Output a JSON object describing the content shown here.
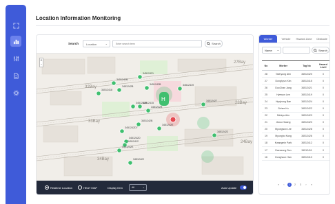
{
  "page": {
    "title": "Location Information Monitoring"
  },
  "sidebar": {
    "items": [
      {
        "icon": "expand-icon"
      },
      {
        "icon": "chart-icon",
        "active": true
      },
      {
        "icon": "sliders-icon"
      },
      {
        "icon": "document-icon"
      },
      {
        "icon": "gear-icon"
      }
    ]
  },
  "search": {
    "label": "Search",
    "category": "Location",
    "placeholder": "Enter search term",
    "button": "Search"
  },
  "map": {
    "bay_labels": [
      "27Bay",
      "32Bay",
      "28Bay",
      "33Bay",
      "24Bay",
      "34Bay"
    ],
    "tags": [
      "34512421",
      "3451242B",
      "3451242B",
      "3451242B",
      "34512419",
      "34512427",
      "34512418",
      "3451242B",
      "34512415",
      "3451242B",
      "3451242B",
      "3451242D7",
      "3451242D",
      "3451242E",
      "34512412",
      "3451242E",
      "34512422",
      "34512422",
      "3451242B"
    ],
    "zoom_in": "+",
    "zoom_out": "-"
  },
  "map_bottom": {
    "realtime_label": "Realtime Location",
    "heatmap_label": "HEAT MAP",
    "display_label": "Display Item",
    "display_value": "All",
    "auto_update_label": "Auto Update"
  },
  "right_panel": {
    "tabs": [
      "Worker",
      "Vehicle",
      "Hazard Zone",
      "Obstacle"
    ],
    "filter": {
      "field": "Name",
      "button": "Search"
    },
    "columns": [
      "No",
      "Worker",
      "Tag No",
      "Hazard Level"
    ],
    "rows": [
      [
        "28",
        "Taehyung Ahn",
        "34512420",
        "0"
      ],
      [
        "27",
        "Donghyun Kim",
        "34512415",
        "0"
      ],
      [
        "26",
        "DooChan Jang",
        "34512421",
        "0"
      ],
      [
        "25",
        "Hyewon Lee",
        "34512419",
        "0"
      ],
      [
        "24",
        "Hyojeong Bae",
        "34512424",
        "0"
      ],
      [
        "23",
        "Sohee Ko",
        "34512422",
        "0"
      ],
      [
        "22",
        "Minkyu Ahn",
        "34512423",
        "0"
      ],
      [
        "21",
        "Jiwoo Hwang",
        "34512423",
        "0"
      ],
      [
        "20",
        "Myungwon Lee",
        "34512428",
        "0"
      ],
      [
        "19",
        "Myungho Kang",
        "34512426",
        "0"
      ],
      [
        "18",
        "Kwangmin Park",
        "34512412",
        "0"
      ],
      [
        "17",
        "Daeseong Son",
        "34512411",
        "0"
      ],
      [
        "16",
        "Donghoon Han",
        "34512413",
        "0"
      ]
    ],
    "pagination": [
      "«",
      "‹",
      "1",
      "2",
      "3",
      "›",
      "»"
    ],
    "current_page": "1"
  }
}
